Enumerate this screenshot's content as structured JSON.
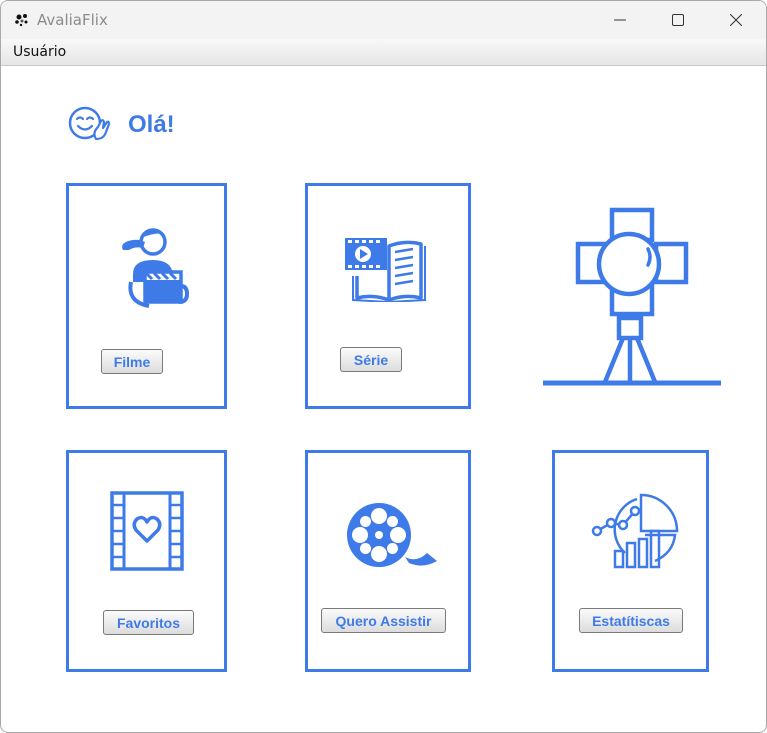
{
  "window": {
    "title": "AvaliaFlix",
    "icon": "film-reel-icon",
    "controls": [
      "minimize-icon",
      "maximize-icon",
      "close-icon"
    ]
  },
  "menu": {
    "items": [
      {
        "label": "Usuário"
      }
    ]
  },
  "greeting": {
    "text": "Olá!",
    "icon": "waving-smiley-icon"
  },
  "cards": {
    "filme": {
      "label": "Filme",
      "icon": "person-with-clapperboard-icon"
    },
    "serie": {
      "label": "Série",
      "icon": "video-and-book-icon"
    },
    "favoritos": {
      "label": "Favoritos",
      "icon": "film-strip-heart-icon"
    },
    "quero_assistir": {
      "label": "Quero Assistir",
      "icon": "film-reel-icon"
    },
    "estatisticas": {
      "label": "Estatítiscas",
      "icon": "chart-analytics-icon"
    }
  },
  "decoration": {
    "icon": "studio-spotlight-icon"
  },
  "colors": {
    "accent": "#3f7be8",
    "card_border": "#3f7be8"
  }
}
